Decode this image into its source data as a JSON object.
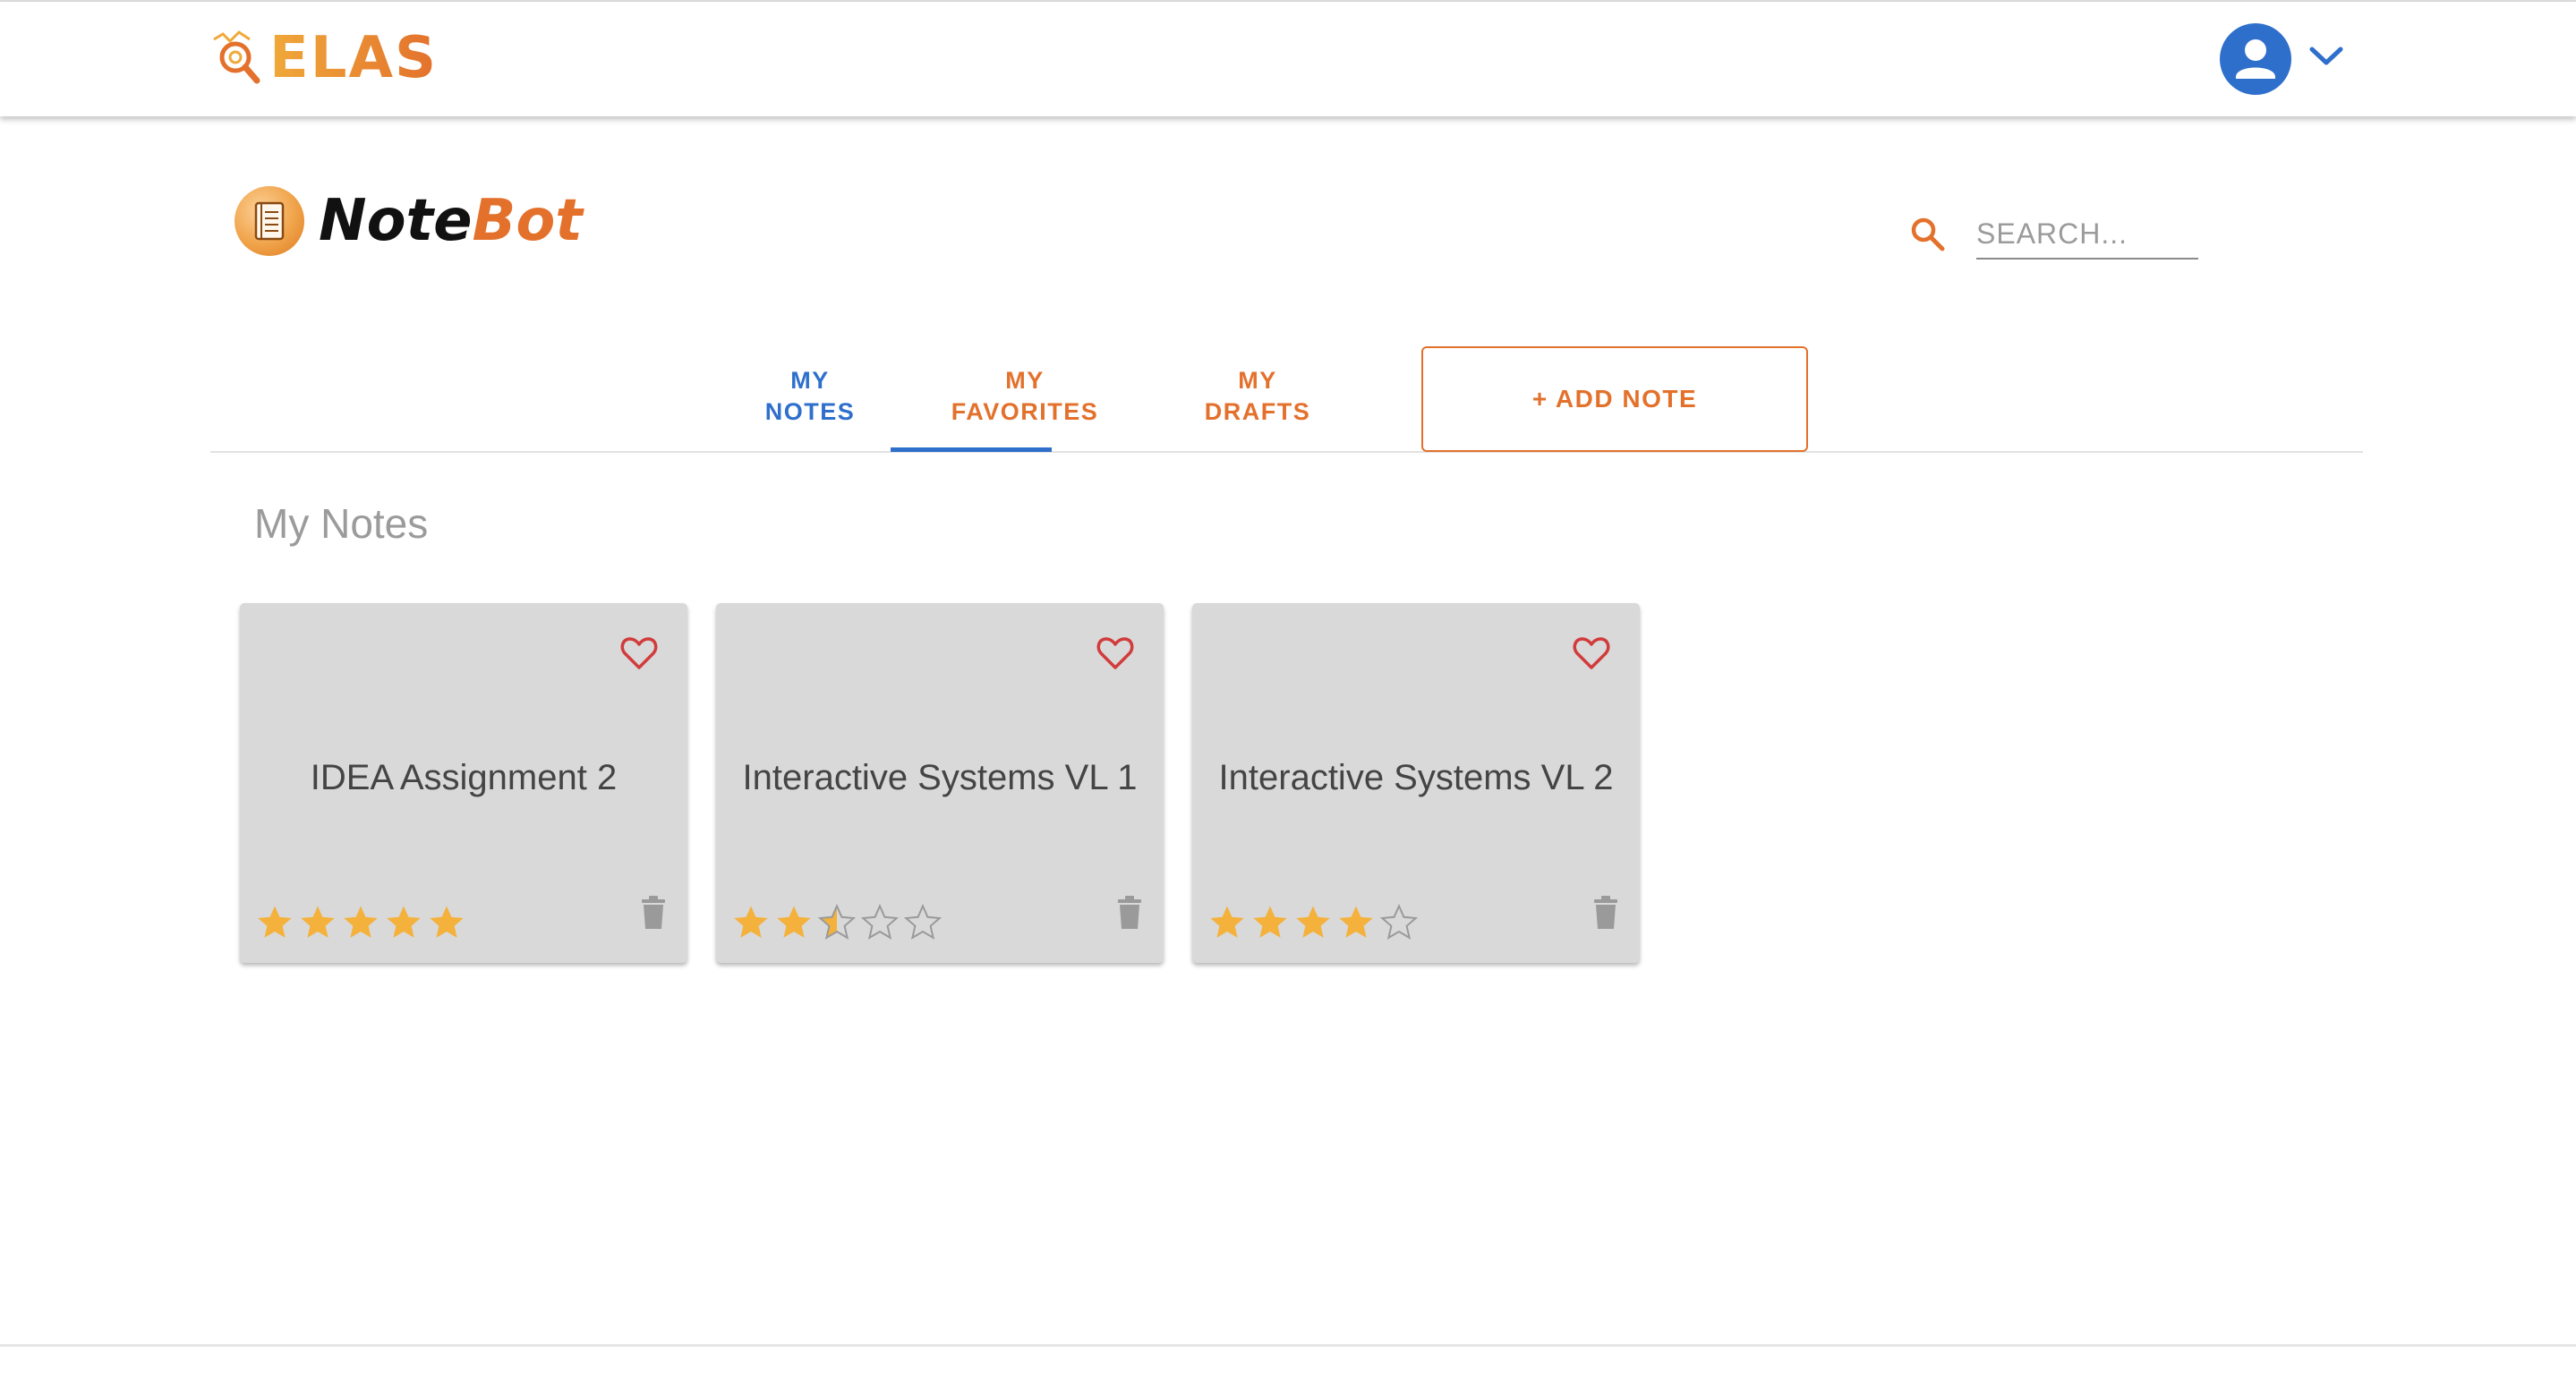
{
  "app": {
    "name": "ELAS"
  },
  "header": {
    "brand_part1": "Note",
    "brand_part2": "Bot",
    "search_placeholder": "SEARCH..."
  },
  "tabs": [
    {
      "line1": "MY",
      "line2": "NOTES",
      "active": true
    },
    {
      "line1": "MY",
      "line2": "FAVORITES",
      "active": false
    },
    {
      "line1": "MY",
      "line2": "DRAFTS",
      "active": false
    }
  ],
  "add_note_label": "+ ADD NOTE",
  "section_title": "My Notes",
  "notes": [
    {
      "title": "IDEA Assignment 2",
      "rating": 5,
      "favorite_icon": "heart-outline-icon"
    },
    {
      "title": "Interactive Systems VL 1",
      "rating": 2.5,
      "favorite_icon": "heart-outline-icon"
    },
    {
      "title": "Interactive Systems VL 2",
      "rating": 4,
      "favorite_icon": "heart-outline-icon"
    }
  ],
  "rating_max": 5,
  "colors": {
    "accent_orange": "#e3712c",
    "accent_blue": "#2f6fcc",
    "star": "#f4b13b",
    "heart": "#d23b3b",
    "card_background": "#d9d9d9"
  }
}
